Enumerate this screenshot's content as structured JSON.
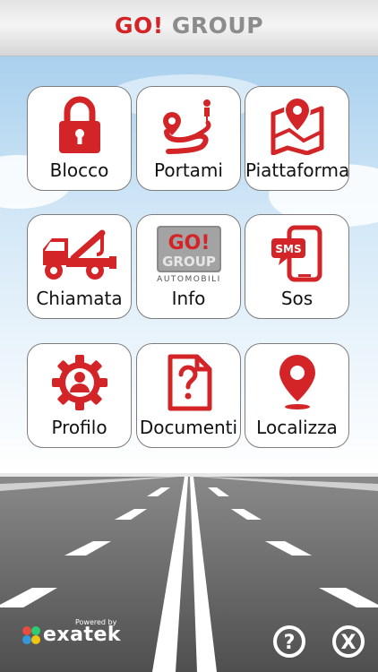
{
  "header": {
    "logo_go": "GO!",
    "logo_group": "GROUP"
  },
  "tiles": [
    {
      "label": "Blocco",
      "icon": "padlock-icon"
    },
    {
      "label": "Portami",
      "icon": "route-icon"
    },
    {
      "label": "Piattaforma",
      "icon": "map-pin-icon"
    },
    {
      "label": "Chiamata",
      "icon": "tow-truck-icon"
    },
    {
      "label": "Info",
      "icon": "go-group-logo-icon",
      "logo_top": "GO!",
      "logo_mid": "GROUP",
      "logo_sub": "AUTOMOBILI"
    },
    {
      "label": "Sos",
      "icon": "sms-phone-icon",
      "badge": "SMS"
    },
    {
      "label": "Profilo",
      "icon": "gear-user-icon"
    },
    {
      "label": "Documenti",
      "icon": "document-question-icon"
    },
    {
      "label": "Localizza",
      "icon": "location-pin-icon"
    }
  ],
  "footer": {
    "powered_by": "Powered by",
    "brand": "exatek",
    "help": "?",
    "close": "X"
  },
  "colors": {
    "accent": "#d32428",
    "road": "#6a6a6a",
    "header_grey": "#8c8c8c"
  }
}
